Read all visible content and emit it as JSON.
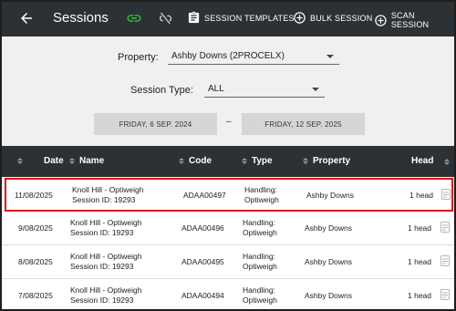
{
  "header": {
    "title": "Sessions",
    "actions": {
      "session_templates": "SESSION TEMPLATES",
      "bulk_session": "BULK SESSION",
      "scan_session": "SCAN SESSION"
    },
    "colors": {
      "bar": "#2c3135",
      "link_green": "#3cc13c"
    }
  },
  "filters": {
    "property_label": "Property:",
    "property_value": "Ashby Downs (2PROCELX)",
    "session_type_label": "Session Type:",
    "session_type_value": "ALL",
    "date_from": "FRIDAY, 6 SEP. 2024",
    "date_separator": "–",
    "date_to": "FRIDAY, 12 SEP. 2025"
  },
  "table": {
    "columns": [
      "Date",
      "Name",
      "Code",
      "Type",
      "Property",
      "Head"
    ],
    "rows": [
      {
        "date": "11/08/2025",
        "name": "Knoll Hill  - Optiweigh",
        "session": "Session ID: 19293",
        "code": "ADAA00497",
        "type1": "Handling:",
        "type2": "Optiweigh",
        "property": "Ashby Downs",
        "head": "1 head"
      },
      {
        "date": "9/08/2025",
        "name": "Knoll Hill  - Optiweigh",
        "session": "Session ID: 19293",
        "code": "ADAA00496",
        "type1": "Handling:",
        "type2": "Optiweigh",
        "property": "Ashby Downs",
        "head": "1 head"
      },
      {
        "date": "8/08/2025",
        "name": "Knoll Hill  - Optiweigh",
        "session": "Session ID: 19293",
        "code": "ADAA00495",
        "type1": "Handling:",
        "type2": "Optiweigh",
        "property": "Ashby Downs",
        "head": "1 head"
      },
      {
        "date": "7/08/2025",
        "name": "Knoll Hill  - Optiweigh",
        "session": "Session ID: 19293",
        "code": "ADAA00494",
        "type1": "Handling:",
        "type2": "Optiweigh",
        "property": "Ashby Downs",
        "head": "1 head"
      }
    ],
    "selected_row_color": "#e0151d"
  }
}
